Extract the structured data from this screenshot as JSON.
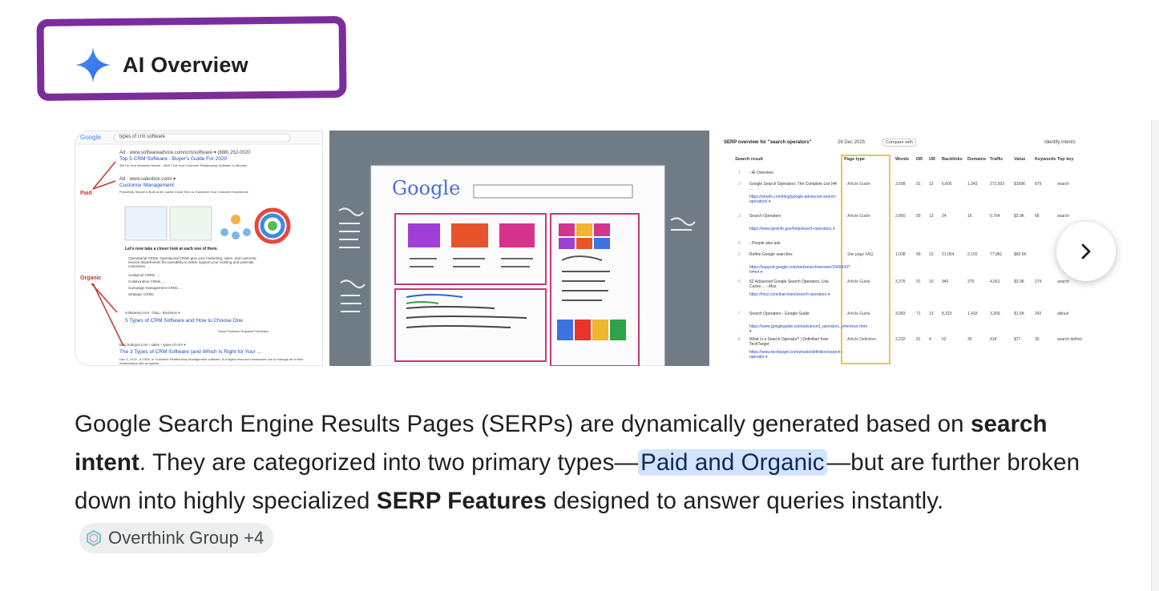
{
  "header": {
    "title": "AI Overview",
    "icon": "sparkle-icon"
  },
  "images": {
    "serp_example": {
      "search_query": "types of crm software",
      "ad1_url": "Ad · www.softwareadvice.com/crm/software ▾ (888) 252-0020",
      "ad1_title": "Top 5 CRM Software - Buyer's Guide For 2020",
      "ad1_desc": "Tell Us Your Business Needs - We'll Find Your Customer Relationship Software in Minutes.",
      "ad2_url": "Ad · www.salesbox.com/ ▾",
      "ad2_title": "Customer Management",
      "ad2_desc": "Powerfully Simple & Built at the Latest Cloud Tech to Transform Your Customer Experience",
      "label_paid": "Paid",
      "label_organic": "Organic",
      "snippet_heading": "Let's now take a closer look at each one of them.",
      "bullets": [
        "Operational CRMs. Operational CRMs give your marketing, sales, and customer service departments the possibility to better support your existing and potential customers. ...",
        "Analytical CRMs. ...",
        "Collaborative CRMs. ...",
        "Campaign management CRMs. ...",
        "Strategic CRMs."
      ],
      "result1_url": "softwareui.com › blog › Business ▾",
      "result1_title": "5 Types of CRM Software and How to Choose One",
      "feedback": "About Featured Snippets   Feedback",
      "result2_url": "blog.hubspot.com › sales › types-of-crm ▾",
      "result2_title": "The 3 Types of CRM Software (and Which Is Right for Your ...",
      "result2_desc": "Dec 3, 2019 - A CRM, or Customer Relationship Management software, is a digital resource businesses use to manage all of their relationships with prospects ..."
    },
    "illustration": {
      "logo_text": "Google"
    },
    "serp_table": {
      "heading": "SERP overview for \"search operators\"",
      "date": "26 Dec 2025",
      "compare": "Compare with",
      "identify": "Identify intents",
      "columns": [
        "Search result",
        "Page type",
        "Words",
        "DR",
        "UR",
        "Backlinks",
        "Domains",
        "Traffic",
        "Value",
        "Keywords",
        "Top key"
      ],
      "rows": [
        {
          "n": "1",
          "title": "› AI Overview",
          "url": "",
          "type": "",
          "vals": []
        },
        {
          "n": "2",
          "title": "Google Search Operators: The Complete List (44 ...",
          "url": "https://ahrefs.com/blog/google-advanced-search-operators/ ▾",
          "type": "Article  Guide",
          "vals": [
            "3,508",
            "91",
            "13",
            "6,805",
            "1,343",
            "272,503",
            "$169K",
            "879",
            "search"
          ]
        },
        {
          "n": "3",
          "title": "Search Operators",
          "url": "https://www.govinfo.gov/help/search-operators ▾",
          "type": "Article  Guide",
          "vals": [
            "2,860",
            "90",
            "13",
            "24",
            "16",
            "5,764",
            "$3.9K",
            "68",
            "search"
          ]
        },
        {
          "n": "4",
          "title": "› People also ask",
          "url": "",
          "type": "",
          "vals": []
        },
        {
          "n": "5",
          "title": "Refine Google searches",
          "url": "https://support.google.com/websearch/answer/2466433?hl=en ▾",
          "type": "Site page  FAQ",
          "vals": [
            "1,038",
            "99",
            "23",
            "21,954",
            "2,102",
            "77,881",
            "$60.5K",
            "",
            ""
          ]
        },
        {
          "n": "6",
          "title": "62 Advanced Google Search Operators, Use Cases ... - Moz",
          "url": "https://moz.com/learn/seo/search-operators ▾",
          "type": "Article  Guide",
          "vals": [
            "3,376",
            "91",
            "10",
            "940",
            "379",
            "4,061",
            "$3.9K",
            "274",
            "search"
          ]
        },
        {
          "n": "7",
          "title": "Search Operators - Google Guide",
          "url": "https://www.googleguide.com/advanced_operators_reference.html ▾",
          "type": "Article  Guide",
          "vals": [
            "3,083",
            "71",
            "13",
            "8,323",
            "1,433",
            "3,399",
            "$1.5K",
            "242",
            "allinurl"
          ]
        },
        {
          "n": "8",
          "title": "What Is a Search Operator? | Definition from TechTarget",
          "url": "https://www.techtarget.com/whatis/definition/search-operator ▾",
          "type": "Article  Definition",
          "vals": [
            "2,232",
            "91",
            "4",
            "63",
            "35",
            "818",
            "$77",
            "35",
            "search definiti"
          ]
        }
      ]
    }
  },
  "carousel": {
    "next_icon": "chevron-right-icon"
  },
  "answer": {
    "p1": "Google Search Engine Results Pages (SERPs) are dynamically generated based on ",
    "b1": "search intent",
    "p2": ". They are categorized into two primary types—",
    "hl": "Paid and Organic",
    "p3": "—but are further broken down into highly specialized ",
    "b2": "SERP Features",
    "p4": " designed to answer queries instantly.",
    "source_chip": "Overthink Group +4"
  }
}
